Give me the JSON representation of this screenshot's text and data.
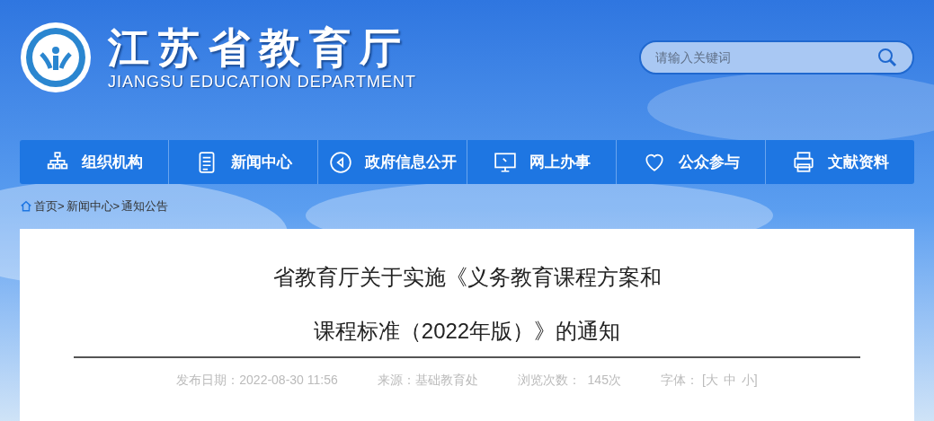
{
  "header": {
    "title": "江苏省教育厅",
    "subtitle": "JIANGSU EDUCATION DEPARTMENT"
  },
  "search": {
    "placeholder": "请输入关键词"
  },
  "nav": [
    {
      "label": "组织机构",
      "kind": "org"
    },
    {
      "label": "新闻中心",
      "kind": "doc"
    },
    {
      "label": "政府信息公开",
      "kind": "play"
    },
    {
      "label": "网上办事",
      "kind": "monitor"
    },
    {
      "label": "公众参与",
      "kind": "heart"
    },
    {
      "label": "文献资料",
      "kind": "printer"
    }
  ],
  "breadcrumb": [
    "首页>",
    "新闻中心>",
    "通知公告"
  ],
  "article": {
    "title_lines": [
      "省教育厅关于实施《义务教育课程方案和",
      "课程标准（2022年版）》的通知"
    ],
    "meta": [
      "发布日期：2022-08-30 11:56",
      "来源：基础教育处",
      "浏览次数：  145次",
      "字体："
    ],
    "font_sizes": [
      "[大",
      "中",
      "小]"
    ]
  }
}
